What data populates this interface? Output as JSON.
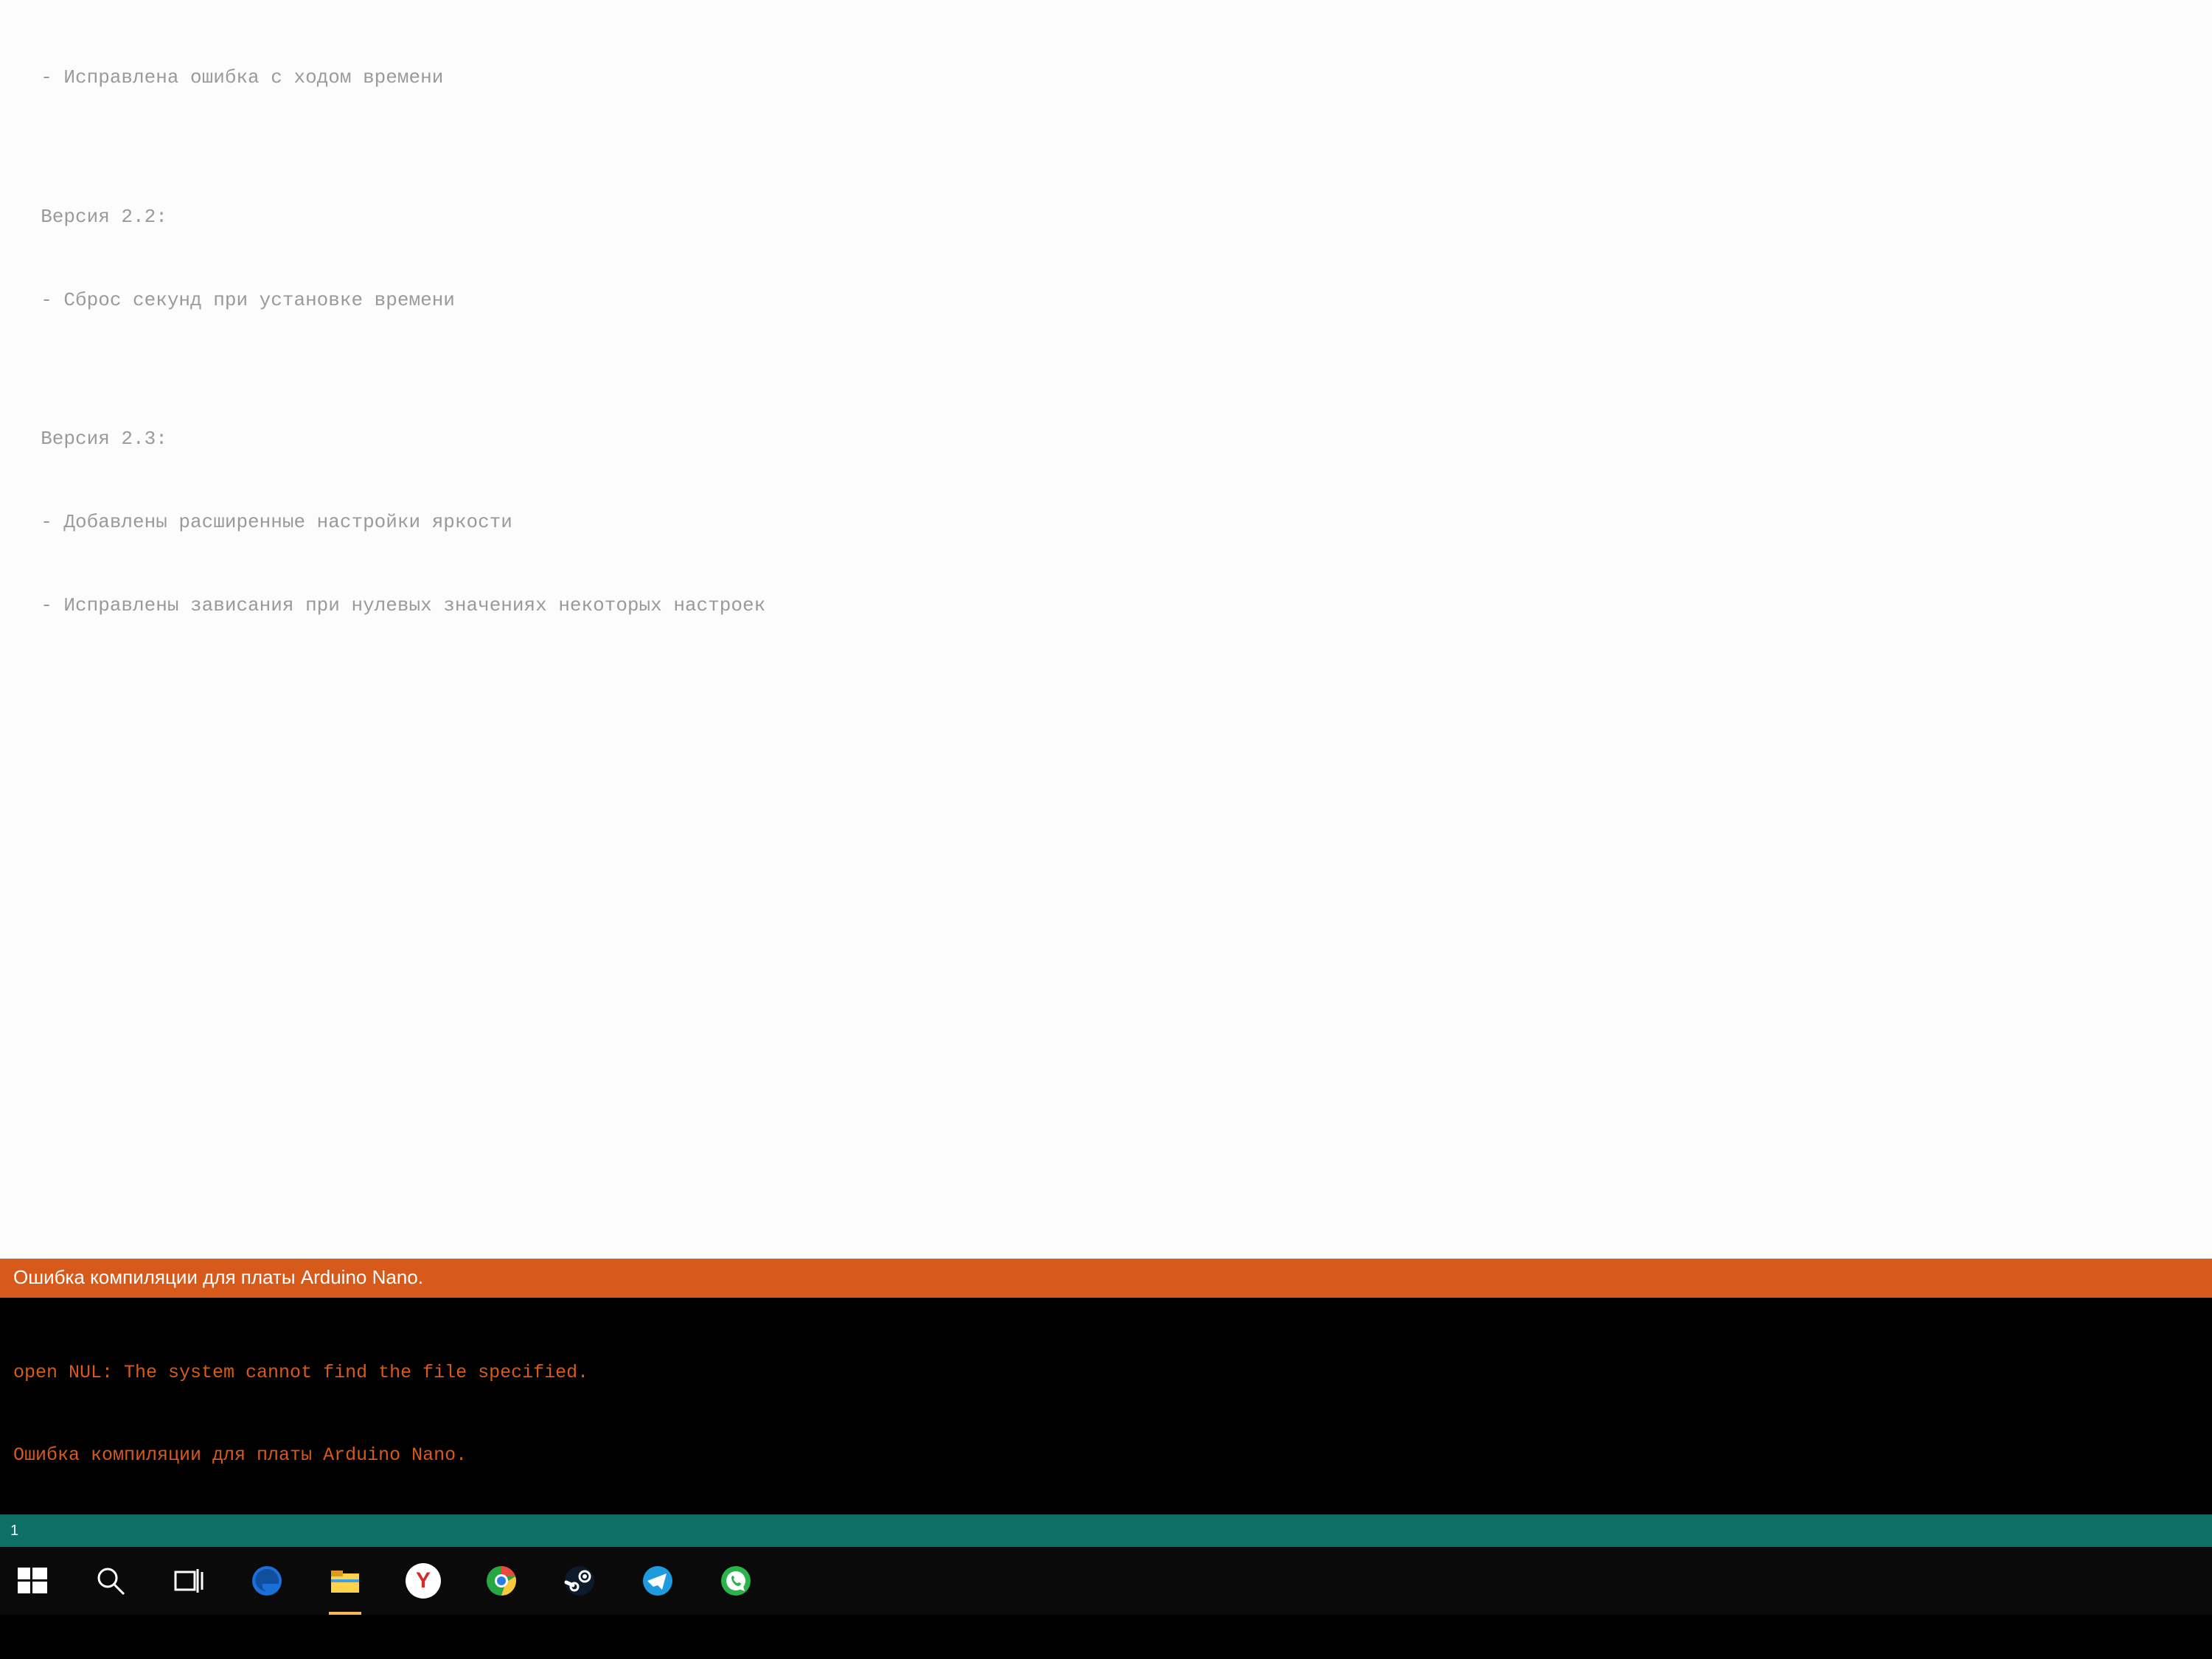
{
  "editor": {
    "lines": [
      "  - Исправлена ошибка с ходом времени",
      "",
      "  Версия 2.2:",
      "  - Сброс секунд при установке времени",
      "",
      "  Версия 2.3:",
      "  - Добавлены расширенные настройки яркости",
      "  - Исправлены зависания при нулевых значениях некоторых настроек"
    ]
  },
  "errorbar": {
    "text": "Ошибка компиляции для платы Arduino Nano."
  },
  "console": {
    "lines": [
      "open NUL: The system cannot find the file specified.",
      "Ошибка компиляции для платы Arduino Nano."
    ]
  },
  "statusbar": {
    "text": "1"
  },
  "taskbar": {
    "items": [
      {
        "name": "start-button",
        "icon": "windows"
      },
      {
        "name": "search-button",
        "icon": "search"
      },
      {
        "name": "taskview-button",
        "icon": "taskview"
      },
      {
        "name": "edge-app",
        "icon": "edge"
      },
      {
        "name": "file-explorer-app",
        "icon": "explorer",
        "active": true
      },
      {
        "name": "yandex-app",
        "icon": "yandex"
      },
      {
        "name": "chrome-app",
        "icon": "chrome"
      },
      {
        "name": "steam-app",
        "icon": "steam"
      },
      {
        "name": "telegram-app",
        "icon": "telegram"
      },
      {
        "name": "whatsapp-app",
        "icon": "whatsapp"
      }
    ]
  }
}
